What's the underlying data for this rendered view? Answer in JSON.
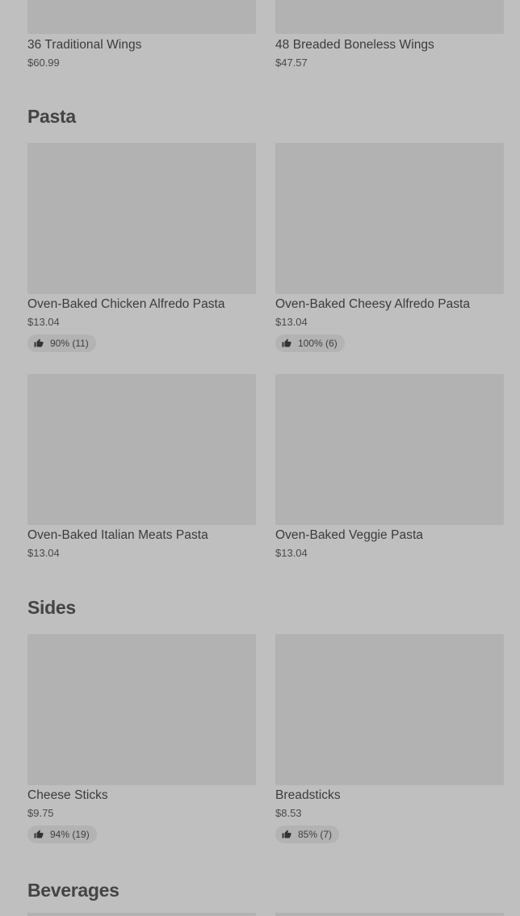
{
  "wings": {
    "items": [
      {
        "name": "36 Traditional Wings",
        "price": "$60.99"
      },
      {
        "name": "48 Breaded Boneless Wings",
        "price": "$47.57"
      }
    ]
  },
  "pasta": {
    "title": "Pasta",
    "items": [
      {
        "name": "Oven-Baked Chicken Alfredo Pasta",
        "price": "$13.04",
        "rating": "90% (11)"
      },
      {
        "name": "Oven-Baked Cheesy Alfredo Pasta",
        "price": "$13.04",
        "rating": "100% (6)"
      },
      {
        "name": "Oven-Baked Italian Meats Pasta",
        "price": "$13.04"
      },
      {
        "name": "Oven-Baked Veggie Pasta",
        "price": "$13.04"
      }
    ]
  },
  "sides": {
    "title": "Sides",
    "items": [
      {
        "name": "Cheese Sticks",
        "price": "$9.75",
        "rating": "94% (19)"
      },
      {
        "name": "Breadsticks",
        "price": "$8.53",
        "rating": "85% (7)"
      }
    ]
  },
  "beverages": {
    "title": "Beverages"
  },
  "icons": {
    "rating_icon": "thumbs-up-icon"
  }
}
